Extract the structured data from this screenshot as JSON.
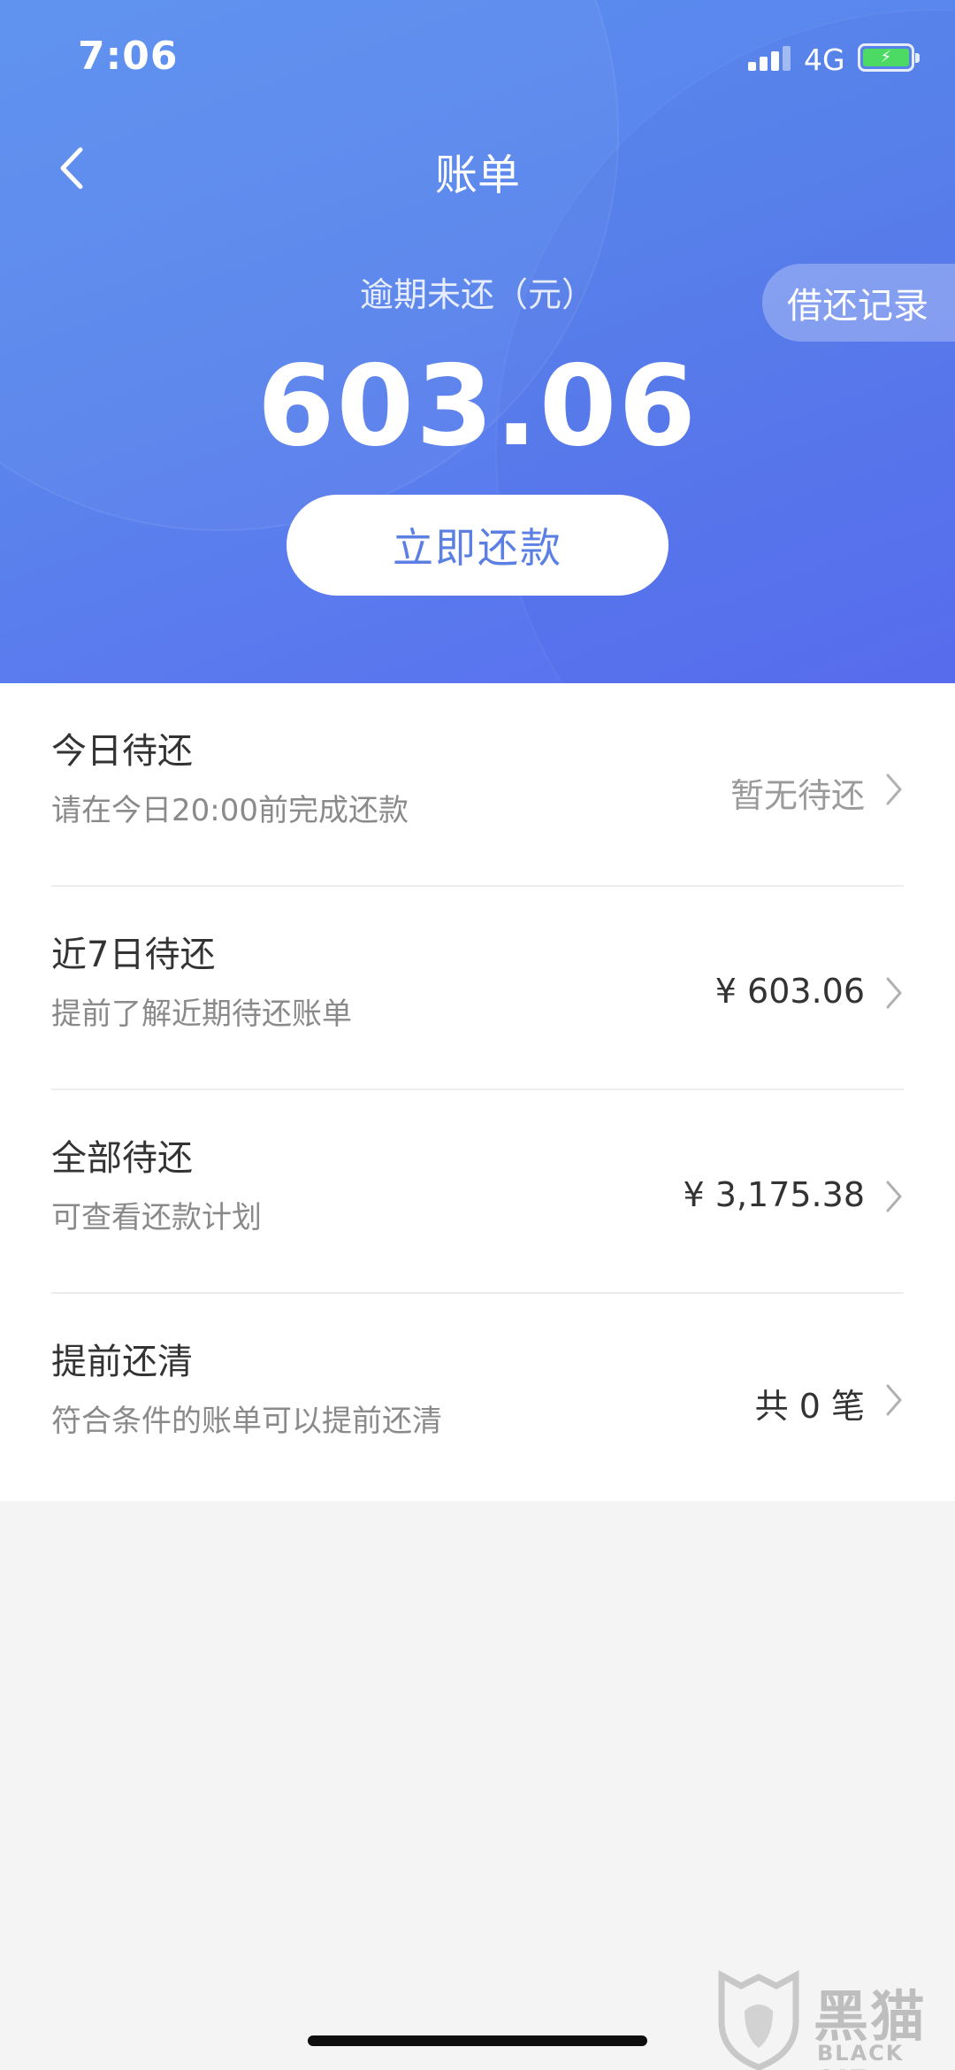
{
  "status_bar": {
    "time": "7:06",
    "network": "4G",
    "battery_charging": true
  },
  "header": {
    "title": "账单",
    "back_icon": "chevron-left-icon",
    "history_label": "借还记录",
    "overdue_label": "逾期未还（元）",
    "overdue_amount": "603.06",
    "repay_button": "立即还款"
  },
  "list": {
    "items": [
      {
        "title": "今日待还",
        "subtitle": "请在今日20:00前完成还款",
        "value": "暂无待还",
        "muted": true
      },
      {
        "title": "近7日待还",
        "subtitle": "提前了解近期待还账单",
        "value": "¥ 603.06",
        "muted": false
      },
      {
        "title": "全部待还",
        "subtitle": "可查看还款计划",
        "value": "¥ 3,175.38",
        "muted": false
      },
      {
        "title": "提前还清",
        "subtitle": "符合条件的账单可以提前还清",
        "value": "共 0 笔",
        "muted": false
      }
    ]
  },
  "watermark": {
    "text": "黑猫",
    "sub": "BLACK CAT"
  },
  "colors": {
    "header_gradient_start": "#5b8ff0",
    "header_gradient_end": "#5a6ef0",
    "repay_text": "#5b7fe3",
    "page_bg": "#f4f4f4"
  }
}
